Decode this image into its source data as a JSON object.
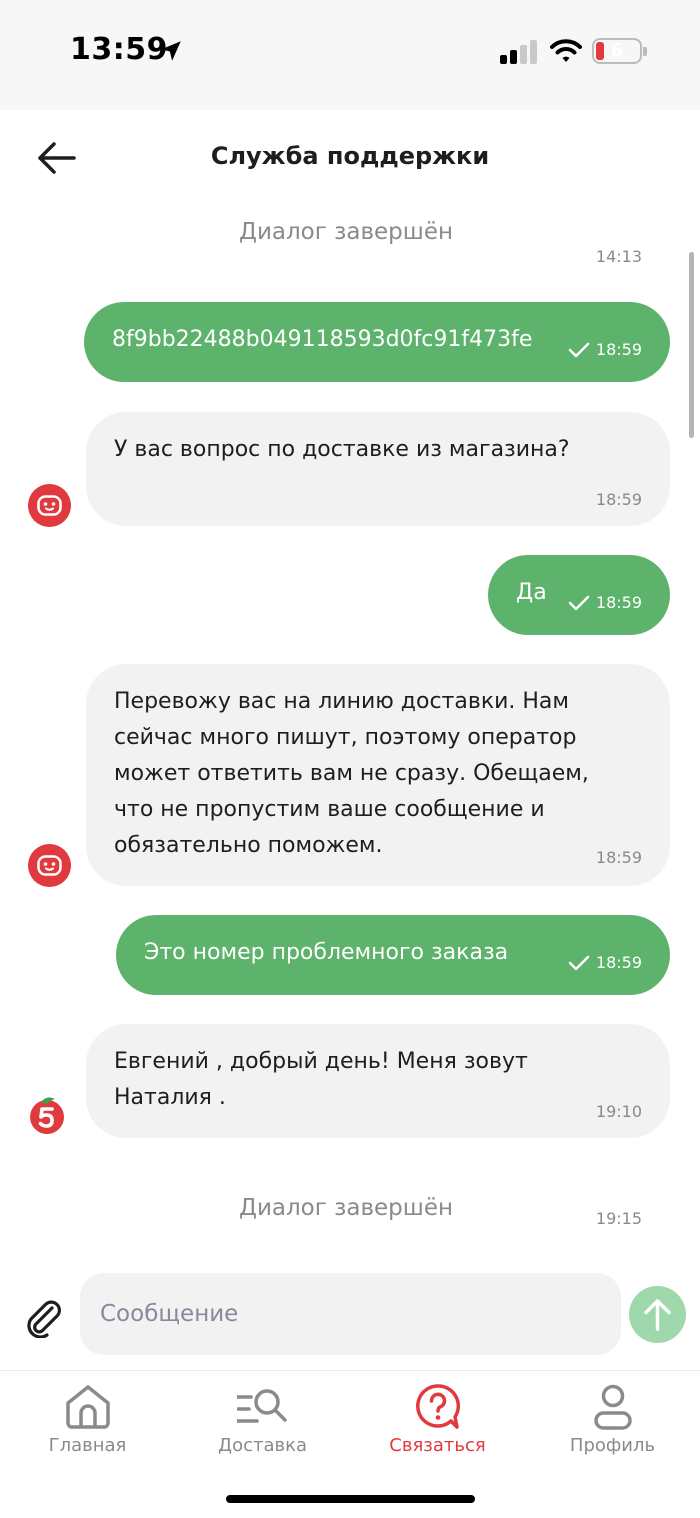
{
  "status_bar": {
    "time": "13:59",
    "battery": "6",
    "icons": [
      "location-arrow-icon",
      "signal-icon",
      "wifi-icon",
      "battery-icon"
    ]
  },
  "header": {
    "title": "Служба поддержки",
    "back_icon": "arrow-left-icon"
  },
  "chat": {
    "system_1": {
      "text": "Диалог завершён",
      "time": "14:13"
    },
    "messages": [
      {
        "direction": "out",
        "text": "8f9bb22488b049118593d0fc91f473fe",
        "time": "18:59",
        "status": "sent"
      },
      {
        "direction": "in",
        "sender": "bot",
        "text": "У вас вопрос по доставке из магазина?",
        "time": "18:59"
      },
      {
        "direction": "out",
        "text": "Да",
        "time": "18:59",
        "status": "sent"
      },
      {
        "direction": "in",
        "sender": "bot",
        "text": "Перевожу вас на линию доставки. Нам\nсейчас много пишут, поэтому оператор\nможет ответить вам не сразу. Обещаем,\nчто не пропустим ваше сообщение и\nобязательно поможем.",
        "time": "18:59"
      },
      {
        "direction": "out",
        "text": "Это номер проблемного заказа",
        "time": "18:59",
        "status": "sent"
      },
      {
        "direction": "in",
        "sender": "operator",
        "text": "Евгений ,  добрый день! Меня зовут\nНаталия .",
        "time": "19:10"
      }
    ],
    "system_2": {
      "text": "Диалог завершён",
      "time": "19:15"
    }
  },
  "composer": {
    "placeholder": "Сообщение",
    "value": ""
  },
  "tabbar": {
    "tabs": [
      {
        "label": "Главная",
        "icon": "home-icon",
        "active": false
      },
      {
        "label": "Доставка",
        "icon": "delivery-search-icon",
        "active": false
      },
      {
        "label": "Связаться",
        "icon": "support-question-icon",
        "active": true
      },
      {
        "label": "Профиль",
        "icon": "profile-icon",
        "active": false
      }
    ]
  },
  "colors": {
    "accent": "#e0393e",
    "outgoing_bubble": "#5db36b",
    "incoming_bubble": "#f2f2f2",
    "send_button": "#9fd8ab"
  }
}
